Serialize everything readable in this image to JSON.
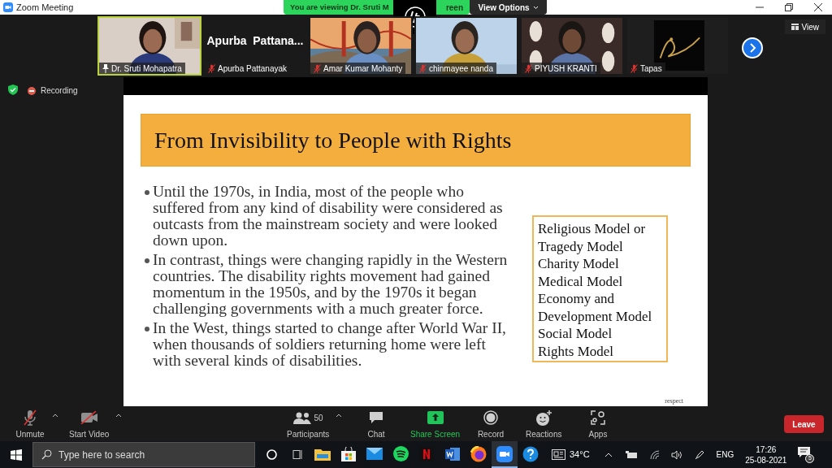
{
  "window": {
    "title": "Zoom Meeting"
  },
  "banner": {
    "text": "You are viewing Dr. Sruti M",
    "tail": "reen"
  },
  "view_options": "View Options",
  "participants": [
    {
      "kind": "video",
      "name": "Dr. Sruti Mohapatra",
      "pinned": true,
      "muted": false,
      "speaking": true
    },
    {
      "kind": "name",
      "display": "Apurba  Pattana...",
      "name": "Apurba Pattanayak",
      "pinned": false,
      "muted": true,
      "speaking": false
    },
    {
      "kind": "video",
      "name": "Amar Kumar Mohanty",
      "pinned": false,
      "muted": true,
      "speaking": false
    },
    {
      "kind": "video",
      "name": "chinmayee nanda",
      "pinned": false,
      "muted": true,
      "speaking": false
    },
    {
      "kind": "video",
      "name": "PIYUSH KRANTI",
      "pinned": false,
      "muted": true,
      "speaking": false
    },
    {
      "kind": "video",
      "name": "Tapas",
      "pinned": false,
      "muted": true,
      "speaking": false
    }
  ],
  "view_button": "View",
  "recording": "Recording",
  "slide": {
    "title": "From Invisibility to People with Rights",
    "bullets": [
      "Until the 1970s, in India, most of the people who suffered from any kind of disability were considered as outcasts from the mainstream society and were looked down upon.",
      "In contrast, things were changing rapidly in the Western countries. The disability rights movement had gained momentum in the 1950s, and by the 1970s it began challenging governments with a much greater force.",
      "In the West, things started to change after World War II, when thousands of soldiers returning home were left with several kinds of disabilities."
    ],
    "models": [
      "Religious Model or",
      "Tragedy Model",
      "Charity Model",
      "Medical Model",
      "Economy and",
      "Development Model",
      "Social Model",
      "Rights Model"
    ],
    "footer": "respect"
  },
  "toolbar": [
    {
      "kind": "mic_off",
      "label": "Unmute",
      "caret": true
    },
    {
      "kind": "video_off",
      "label": "Start Video",
      "caret": true
    },
    {
      "kind": "participants",
      "label": "Participants",
      "count": "50",
      "caret": true
    },
    {
      "kind": "chat",
      "label": "Chat",
      "caret": false
    },
    {
      "kind": "share",
      "label": "Share Screen",
      "caret": false
    },
    {
      "kind": "record",
      "label": "Record",
      "caret": false
    },
    {
      "kind": "reactions",
      "label": "Reactions",
      "caret": false
    },
    {
      "kind": "apps",
      "label": "Apps",
      "caret": false
    }
  ],
  "leave": "Leave",
  "taskbar": {
    "search_placeholder": "Type here to search",
    "temperature": "34°C",
    "language": "ENG",
    "time": "17:26",
    "date": "25-08-2021",
    "notifications": "5",
    "apps": [
      {
        "kind": "explorer",
        "selected": false
      },
      {
        "kind": "store",
        "selected": false
      },
      {
        "kind": "mail",
        "selected": false
      },
      {
        "kind": "spotify",
        "selected": false
      },
      {
        "kind": "netflix",
        "selected": false
      },
      {
        "kind": "word",
        "selected": false
      },
      {
        "kind": "firefox",
        "selected": false
      },
      {
        "kind": "zoom",
        "selected": true
      },
      {
        "kind": "help",
        "selected": false
      }
    ]
  }
}
